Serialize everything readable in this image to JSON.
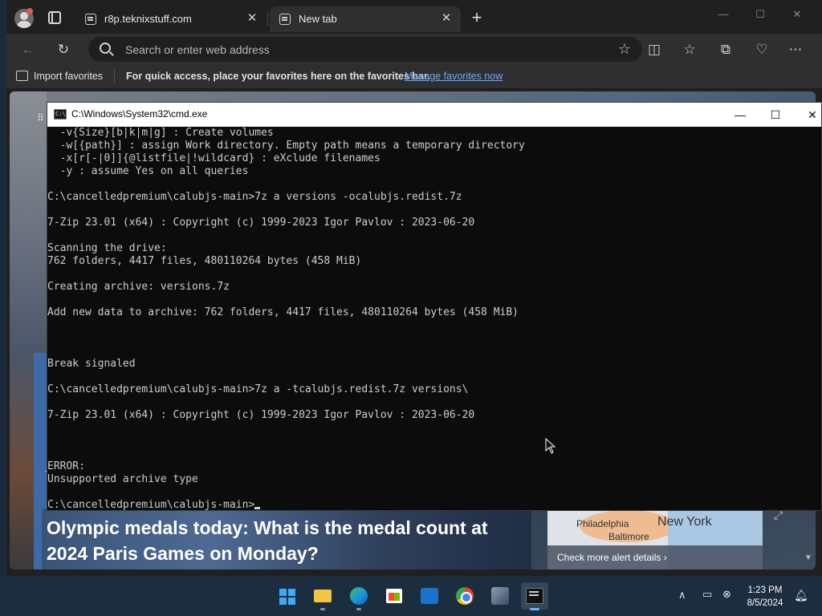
{
  "browser": {
    "tabs": [
      {
        "label": "r8p.teknixstuff.com",
        "active": false
      },
      {
        "label": "New tab",
        "active": true
      }
    ],
    "new_tab_symbol": "+",
    "window_controls": {
      "minimize": "—",
      "maximize": "☐",
      "close": "✕"
    },
    "address": {
      "placeholder": "Search or enter web address"
    },
    "favorites_bar": {
      "import_label": "Import favorites",
      "message": "For quick access, place your favorites here on the favorites bar.",
      "link": "Manage favorites now"
    }
  },
  "page": {
    "headline": "Olympic medals today: What is the medal count at 2024 Paris Games on Monday?",
    "map": {
      "city_philadelphia": "Philadelphia",
      "city_new_york": "New York",
      "city_baltimore": "Baltimore",
      "alert_link": "Check more alert details"
    }
  },
  "cmd": {
    "title": "C:\\Windows\\System32\\cmd.exe",
    "controls": {
      "minimize": "—",
      "maximize": "☐",
      "close": "✕"
    },
    "lines": [
      "  -v{Size}[b|k|m|g] : Create volumes",
      "  -w[{path}] : assign Work directory. Empty path means a temporary directory",
      "  -x[r[-|0]]{@listfile|!wildcard} : eXclude filenames",
      "  -y : assume Yes on all queries",
      "",
      "C:\\cancelledpremium\\calubjs-main>7z a versions -ocalubjs.redist.7z",
      "",
      "7-Zip 23.01 (x64) : Copyright (c) 1999-2023 Igor Pavlov : 2023-06-20",
      "",
      "Scanning the drive:",
      "762 folders, 4417 files, 480110264 bytes (458 MiB)",
      "",
      "Creating archive: versions.7z",
      "",
      "Add new data to archive: 762 folders, 4417 files, 480110264 bytes (458 MiB)",
      "",
      "",
      "",
      "Break signaled",
      "",
      "C:\\cancelledpremium\\calubjs-main>7z a -tcalubjs.redist.7z versions\\",
      "",
      "7-Zip 23.01 (x64) : Copyright (c) 1999-2023 Igor Pavlov : 2023-06-20",
      "",
      "",
      "",
      "ERROR:",
      "Unsupported archive type",
      "",
      "C:\\cancelledpremium\\calubjs-main>"
    ]
  },
  "taskbar": {
    "apps": [
      "start",
      "file-explorer",
      "edge",
      "microsoft-store",
      "outlook",
      "chrome",
      "game",
      "command-prompt"
    ],
    "time": "1:23 PM",
    "date": "8/5/2024"
  }
}
